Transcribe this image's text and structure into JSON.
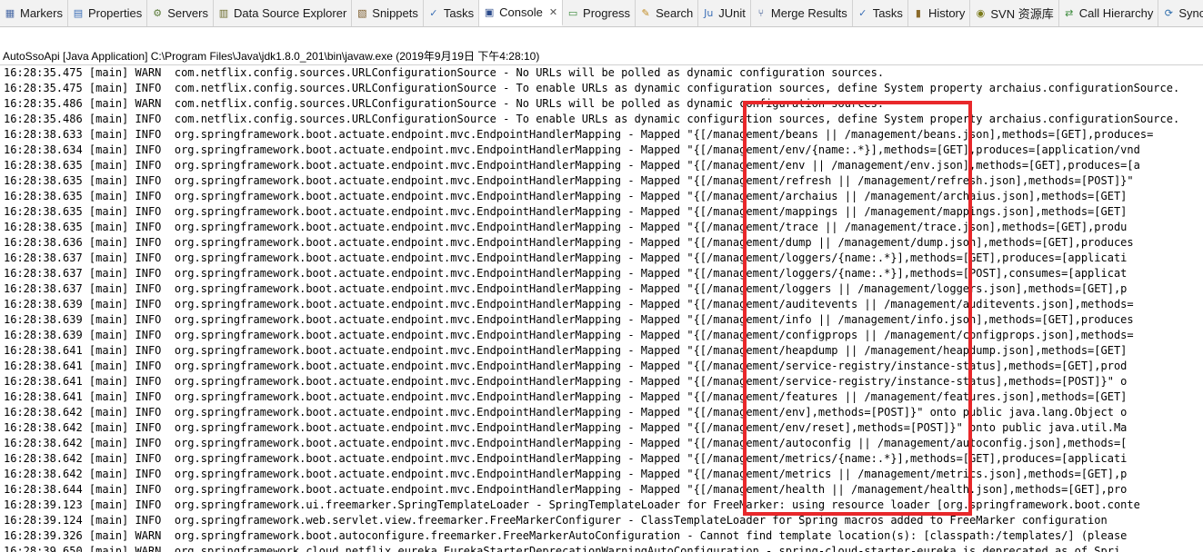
{
  "tabs": [
    {
      "label": "Markers",
      "icon": "markers-icon",
      "glyph": "▦",
      "color": "#4a6aa5"
    },
    {
      "label": "Properties",
      "icon": "properties-icon",
      "glyph": "▤",
      "color": "#3b6fb6"
    },
    {
      "label": "Servers",
      "icon": "servers-icon",
      "glyph": "⚙",
      "color": "#5b7b3a"
    },
    {
      "label": "Data Source Explorer",
      "icon": "data-source-icon",
      "glyph": "▥",
      "color": "#6a6a2a"
    },
    {
      "label": "Snippets",
      "icon": "snippets-icon",
      "glyph": "▧",
      "color": "#7a5a2a"
    },
    {
      "label": "Tasks",
      "icon": "tasks-icon",
      "glyph": "✓",
      "color": "#3b6fb6"
    },
    {
      "label": "Console",
      "icon": "console-icon",
      "glyph": "▣",
      "color": "#2a4a8a",
      "active": true
    },
    {
      "label": "Progress",
      "icon": "progress-icon",
      "glyph": "▭",
      "color": "#3a8a3a"
    },
    {
      "label": "Search",
      "icon": "search-icon",
      "glyph": "✎",
      "color": "#c08a20"
    },
    {
      "label": "JUnit",
      "icon": "junit-icon",
      "glyph": "Ju",
      "color": "#3b6fb6"
    },
    {
      "label": "Merge Results",
      "icon": "merge-icon",
      "glyph": "⑂",
      "color": "#2a4a8a"
    },
    {
      "label": "Tasks",
      "icon": "tasks-icon",
      "glyph": "✓",
      "color": "#3b6fb6"
    },
    {
      "label": "History",
      "icon": "history-icon",
      "glyph": "▮",
      "color": "#8a6a2a"
    },
    {
      "label": "SVN 资源库",
      "icon": "svn-icon",
      "glyph": "◉",
      "color": "#7a7a1a"
    },
    {
      "label": "Call Hierarchy",
      "icon": "call-hierarchy-icon",
      "glyph": "⇄",
      "color": "#3a8a3a"
    },
    {
      "label": "Synch",
      "icon": "synchronize-icon",
      "glyph": "⟳",
      "color": "#2a6aaa"
    }
  ],
  "console": {
    "launch_title": "AutoSsoApi [Java Application] C:\\Program Files\\Java\\jdk1.8.0_201\\bin\\javaw.exe (2019年9月19日 下午4:28:10)",
    "lines": [
      "16:28:35.475 [main] WARN  com.netflix.config.sources.URLConfigurationSource - No URLs will be polled as dynamic configuration sources.",
      "16:28:35.475 [main] INFO  com.netflix.config.sources.URLConfigurationSource - To enable URLs as dynamic configuration sources, define System property archaius.configurationSource.",
      "16:28:35.486 [main] WARN  com.netflix.config.sources.URLConfigurationSource - No URLs will be polled as dynamic configuration sources.",
      "16:28:35.486 [main] INFO  com.netflix.config.sources.URLConfigurationSource - To enable URLs as dynamic configuration sources, define System property archaius.configurationSource.",
      "16:28:38.633 [main] INFO  org.springframework.boot.actuate.endpoint.mvc.EndpointHandlerMapping - Mapped \"{[/management/beans || /management/beans.json],methods=[GET],produces=",
      "16:28:38.634 [main] INFO  org.springframework.boot.actuate.endpoint.mvc.EndpointHandlerMapping - Mapped \"{[/management/env/{name:.*}],methods=[GET],produces=[application/vnd",
      "16:28:38.635 [main] INFO  org.springframework.boot.actuate.endpoint.mvc.EndpointHandlerMapping - Mapped \"{[/management/env || /management/env.json],methods=[GET],produces=[a",
      "16:28:38.635 [main] INFO  org.springframework.boot.actuate.endpoint.mvc.EndpointHandlerMapping - Mapped \"{[/management/refresh || /management/refresh.json],methods=[POST]}\"",
      "16:28:38.635 [main] INFO  org.springframework.boot.actuate.endpoint.mvc.EndpointHandlerMapping - Mapped \"{[/management/archaius || /management/archaius.json],methods=[GET]",
      "16:28:38.635 [main] INFO  org.springframework.boot.actuate.endpoint.mvc.EndpointHandlerMapping - Mapped \"{[/management/mappings || /management/mappings.json],methods=[GET]",
      "16:28:38.635 [main] INFO  org.springframework.boot.actuate.endpoint.mvc.EndpointHandlerMapping - Mapped \"{[/management/trace || /management/trace.json],methods=[GET],produ",
      "16:28:38.636 [main] INFO  org.springframework.boot.actuate.endpoint.mvc.EndpointHandlerMapping - Mapped \"{[/management/dump || /management/dump.json],methods=[GET],produces",
      "16:28:38.637 [main] INFO  org.springframework.boot.actuate.endpoint.mvc.EndpointHandlerMapping - Mapped \"{[/management/loggers/{name:.*}],methods=[GET],produces=[applicati",
      "16:28:38.637 [main] INFO  org.springframework.boot.actuate.endpoint.mvc.EndpointHandlerMapping - Mapped \"{[/management/loggers/{name:.*}],methods=[POST],consumes=[applicat",
      "16:28:38.637 [main] INFO  org.springframework.boot.actuate.endpoint.mvc.EndpointHandlerMapping - Mapped \"{[/management/loggers || /management/loggers.json],methods=[GET],p",
      "16:28:38.639 [main] INFO  org.springframework.boot.actuate.endpoint.mvc.EndpointHandlerMapping - Mapped \"{[/management/auditevents || /management/auditevents.json],methods=",
      "16:28:38.639 [main] INFO  org.springframework.boot.actuate.endpoint.mvc.EndpointHandlerMapping - Mapped \"{[/management/info || /management/info.json],methods=[GET],produces",
      "16:28:38.639 [main] INFO  org.springframework.boot.actuate.endpoint.mvc.EndpointHandlerMapping - Mapped \"{[/management/configprops || /management/configprops.json],methods=",
      "16:28:38.641 [main] INFO  org.springframework.boot.actuate.endpoint.mvc.EndpointHandlerMapping - Mapped \"{[/management/heapdump || /management/heapdump.json],methods=[GET]",
      "16:28:38.641 [main] INFO  org.springframework.boot.actuate.endpoint.mvc.EndpointHandlerMapping - Mapped \"{[/management/service-registry/instance-status],methods=[GET],prod",
      "16:28:38.641 [main] INFO  org.springframework.boot.actuate.endpoint.mvc.EndpointHandlerMapping - Mapped \"{[/management/service-registry/instance-status],methods=[POST]}\" o",
      "16:28:38.641 [main] INFO  org.springframework.boot.actuate.endpoint.mvc.EndpointHandlerMapping - Mapped \"{[/management/features || /management/features.json],methods=[GET]",
      "16:28:38.642 [main] INFO  org.springframework.boot.actuate.endpoint.mvc.EndpointHandlerMapping - Mapped \"{[/management/env],methods=[POST]}\" onto public java.lang.Object o",
      "16:28:38.642 [main] INFO  org.springframework.boot.actuate.endpoint.mvc.EndpointHandlerMapping - Mapped \"{[/management/env/reset],methods=[POST]}\" onto public java.util.Ma",
      "16:28:38.642 [main] INFO  org.springframework.boot.actuate.endpoint.mvc.EndpointHandlerMapping - Mapped \"{[/management/autoconfig || /management/autoconfig.json],methods=[",
      "16:28:38.642 [main] INFO  org.springframework.boot.actuate.endpoint.mvc.EndpointHandlerMapping - Mapped \"{[/management/metrics/{name:.*}],methods=[GET],produces=[applicati",
      "16:28:38.642 [main] INFO  org.springframework.boot.actuate.endpoint.mvc.EndpointHandlerMapping - Mapped \"{[/management/metrics || /management/metrics.json],methods=[GET],p",
      "16:28:38.644 [main] INFO  org.springframework.boot.actuate.endpoint.mvc.EndpointHandlerMapping - Mapped \"{[/management/health || /management/health.json],methods=[GET],pro",
      "16:28:39.123 [main] INFO  org.springframework.ui.freemarker.SpringTemplateLoader - SpringTemplateLoader for FreeMarker: using resource loader [org.springframework.boot.conte",
      "16:28:39.124 [main] INFO  org.springframework.web.servlet.view.freemarker.FreeMarkerConfigurer - ClassTemplateLoader for Spring macros added to FreeMarker configuration",
      "16:28:39.326 [main] WARN  org.springframework.boot.autoconfigure.freemarker.FreeMarkerAutoConfiguration - Cannot find template location(s): [classpath:/templates/] (please",
      "16:28:39.650 [main] WARN  org.springframework.cloud.netflix.eureka.EurekaStarterDeprecationWarningAutoConfiguration - spring-cloud-starter-eureka is deprecated as of Spri"
    ]
  },
  "highlight_color": "#e8282b"
}
